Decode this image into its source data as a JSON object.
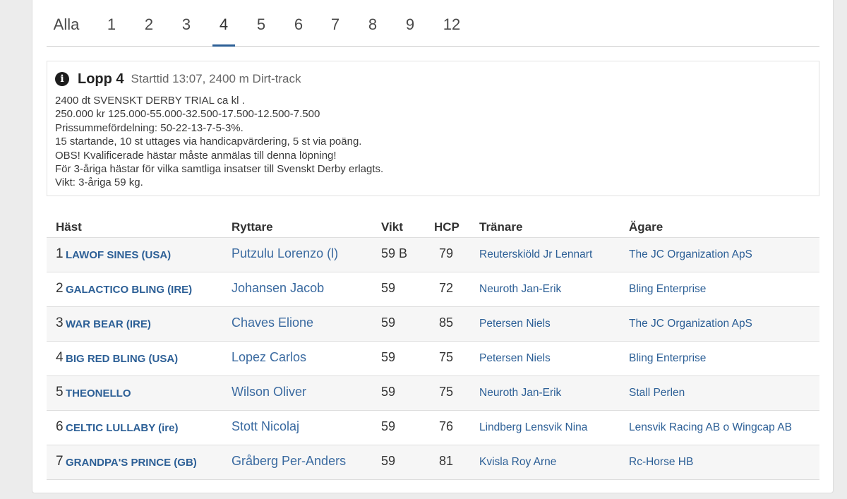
{
  "tabs": [
    "Alla",
    "1",
    "2",
    "3",
    "4",
    "5",
    "6",
    "7",
    "8",
    "9",
    "12"
  ],
  "active_tab": "4",
  "race": {
    "title": "Lopp 4",
    "subtitle": "Starttid 13:07, 2400 m Dirt-track",
    "description": [
      "2400 dt SVENSKT DERBY TRIAL ca kl .",
      "250.000 kr 125.000-55.000-32.500-17.500-12.500-7.500",
      "Prissummefördelning: 50-22-13-7-5-3%.",
      "15 startande, 10 st uttages via handicapvärdering, 5 st via poäng.",
      "OBS! Kvalificerade hästar måste anmälas till denna löpning!",
      "För 3-åriga hästar för vilka samtliga insatser till Svenskt Derby erlagts.",
      "Vikt: 3-åriga 59 kg."
    ]
  },
  "columns": {
    "horse": "Häst",
    "rider": "Ryttare",
    "weight": "Vikt",
    "hcp": "HCP",
    "trainer": "Tränare",
    "owner": "Ägare"
  },
  "rows": [
    {
      "num": "1",
      "horse": "LAWOF SINES (USA)",
      "rider": "Putzulu Lorenzo (l)",
      "weight": "59 B",
      "hcp": "79",
      "trainer": "Reuterskiöld Jr Lennart",
      "owner": "The JC Organization ApS"
    },
    {
      "num": "2",
      "horse": "GALACTICO BLING (IRE)",
      "rider": "Johansen Jacob",
      "weight": "59",
      "hcp": "72",
      "trainer": "Neuroth Jan-Erik",
      "owner": "Bling Enterprise"
    },
    {
      "num": "3",
      "horse": "WAR BEAR (IRE)",
      "rider": "Chaves Elione",
      "weight": "59",
      "hcp": "85",
      "trainer": "Petersen Niels",
      "owner": "The JC Organization ApS"
    },
    {
      "num": "4",
      "horse": "BIG RED BLING (USA)",
      "rider": "Lopez Carlos",
      "weight": "59",
      "hcp": "75",
      "trainer": "Petersen Niels",
      "owner": "Bling Enterprise"
    },
    {
      "num": "5",
      "horse": "THEONELLO",
      "rider": "Wilson Oliver",
      "weight": "59",
      "hcp": "75",
      "trainer": "Neuroth Jan-Erik",
      "owner": "Stall Perlen"
    },
    {
      "num": "6",
      "horse": "CELTIC LULLABY (ire)",
      "rider": "Stott Nicolaj",
      "weight": "59",
      "hcp": "76",
      "trainer": "Lindberg Lensvik Nina",
      "owner": "Lensvik Racing AB o Wingcap AB"
    },
    {
      "num": "7",
      "horse": "GRANDPA'S PRINCE (GB)",
      "rider": "Gråberg Per-Anders",
      "weight": "59",
      "hcp": "81",
      "trainer": "Kvisla Roy Arne",
      "owner": "Rc-Horse HB"
    }
  ],
  "icons": {
    "info": "info-circle-icon"
  },
  "colors": {
    "link": "#2c5f96",
    "active_tab_underline": "#2c5f96",
    "row_alt": "#f6f6f6"
  }
}
